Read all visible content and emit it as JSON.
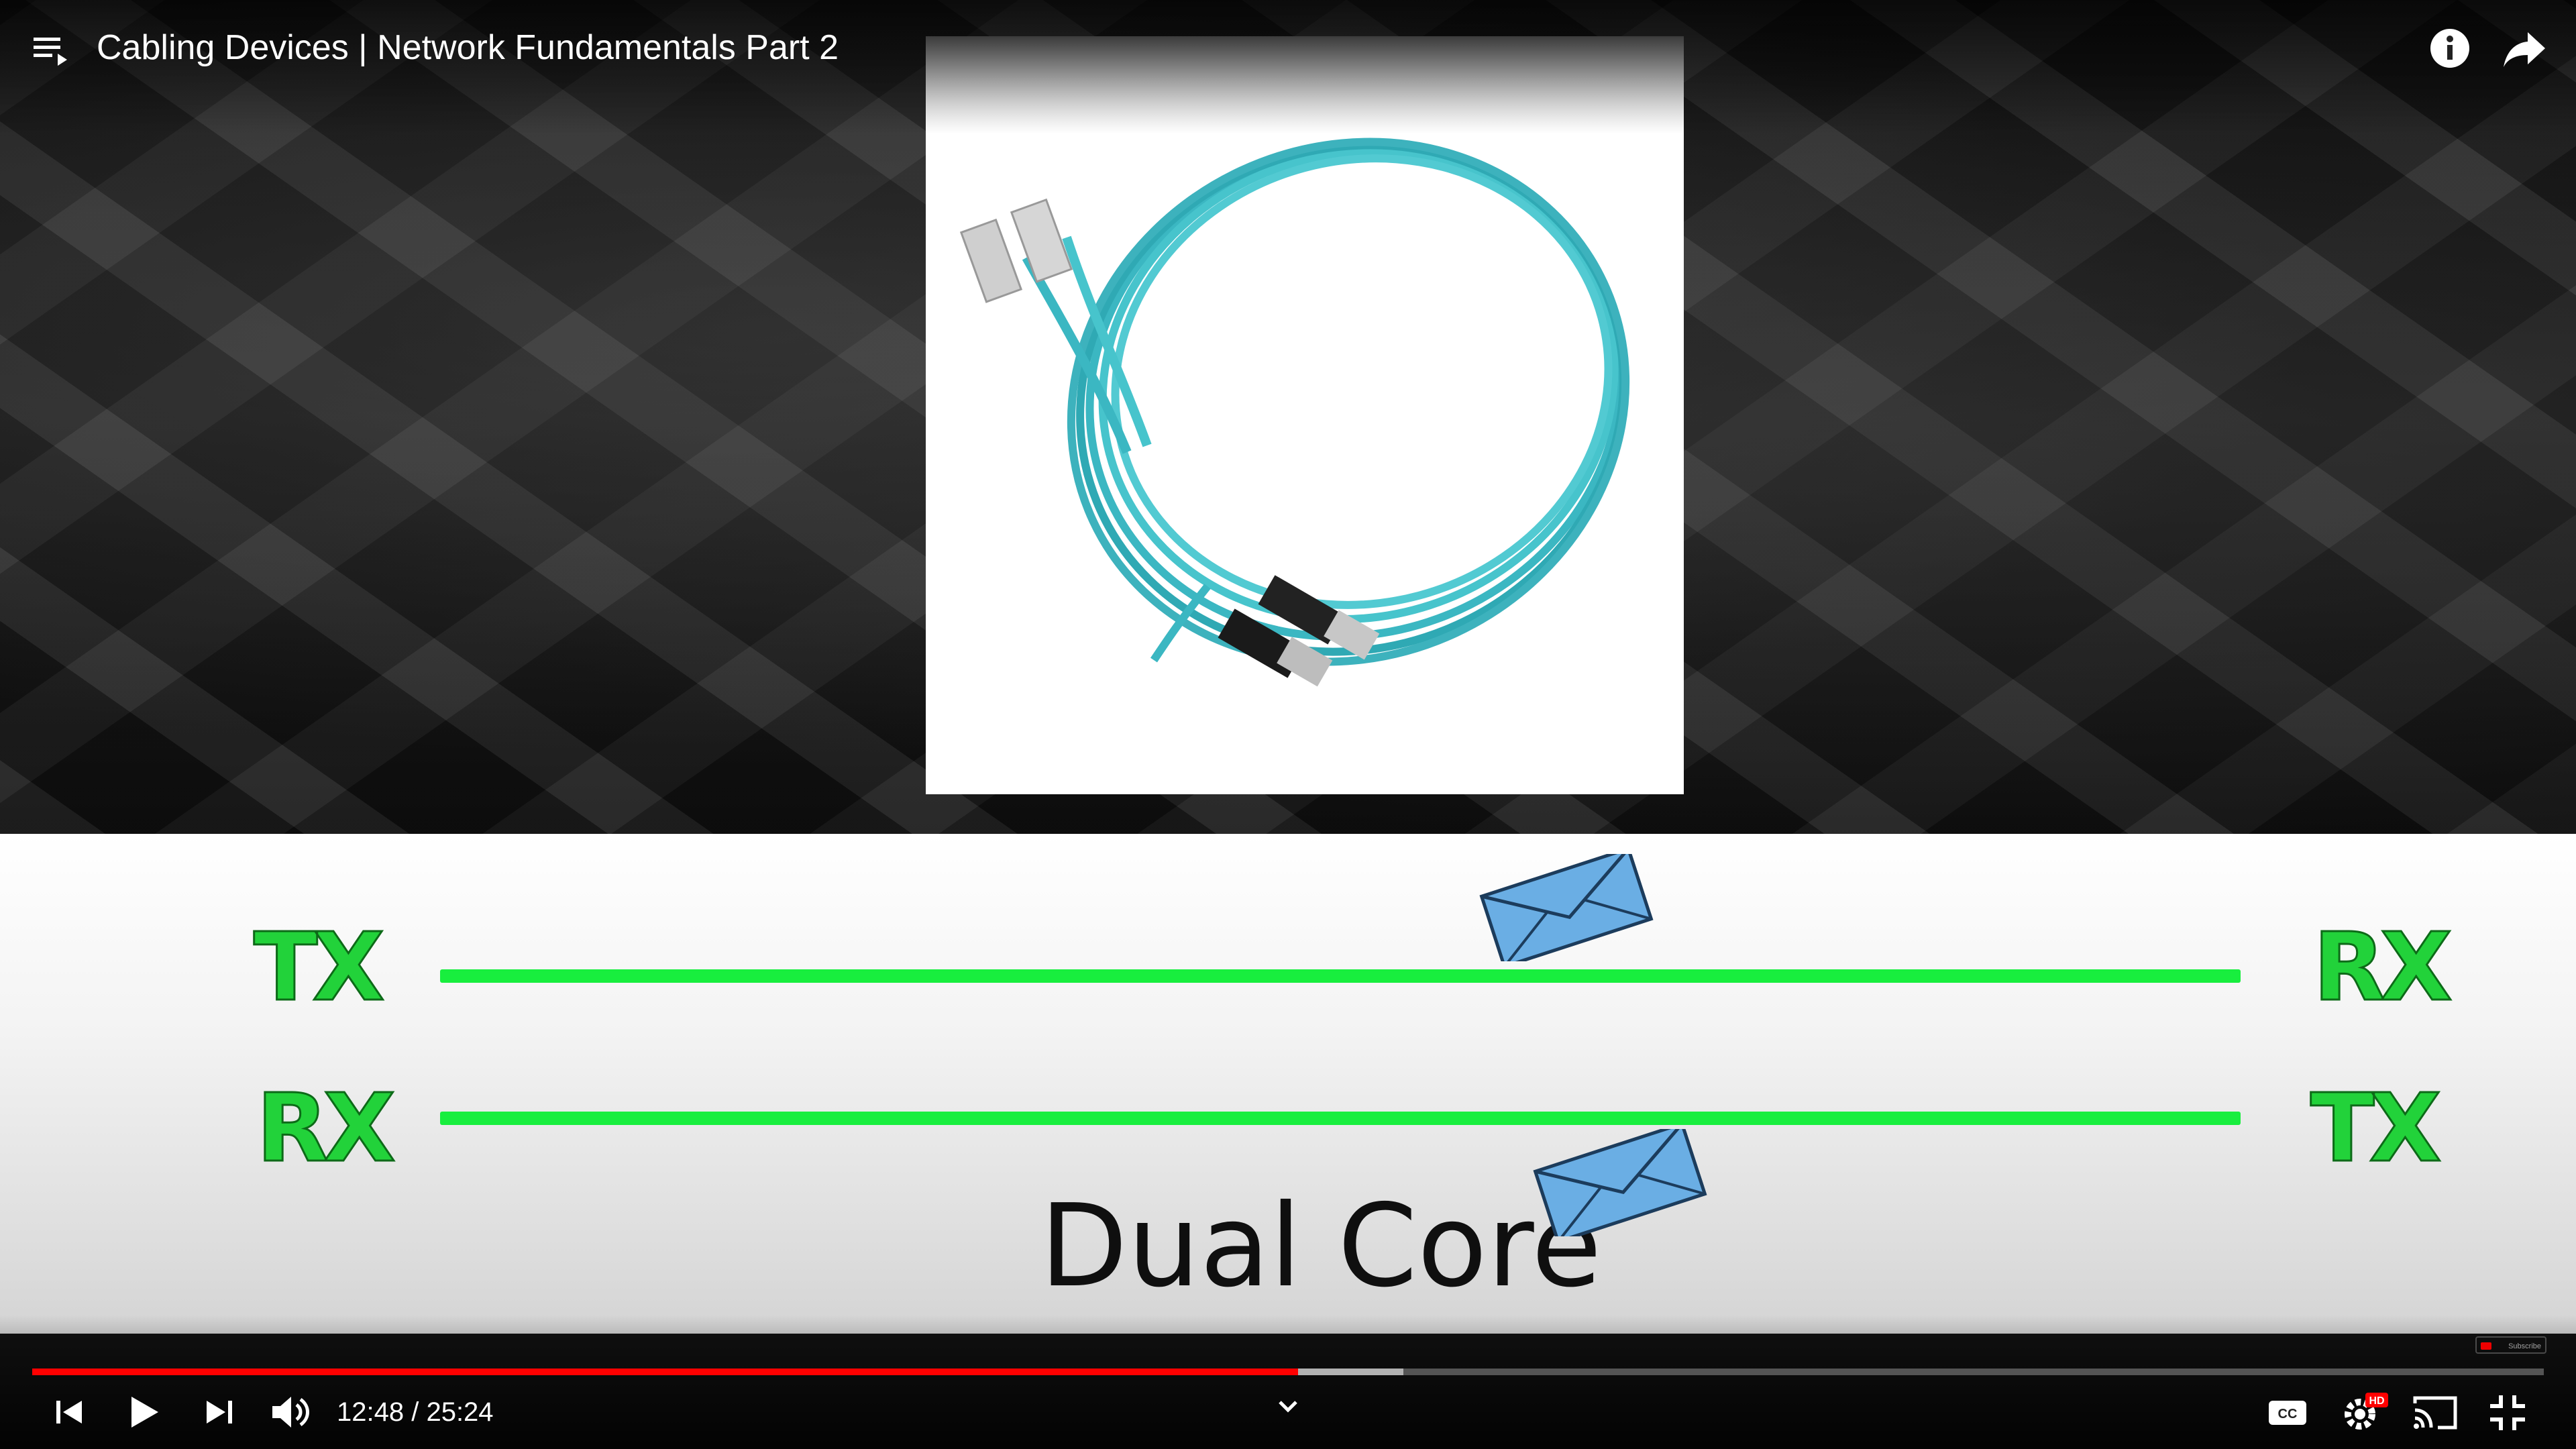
{
  "header": {
    "title": "Cabling Devices | Network Fundamentals Part 2"
  },
  "slide": {
    "top_left_label": "TX",
    "top_right_label": "RX",
    "bottom_left_label": "RX",
    "bottom_right_label": "TX",
    "caption": "Dual Core",
    "line_color": "#18ee3e",
    "label_color": "#22d23a",
    "envelope_color": "#6aaee4"
  },
  "player": {
    "current_time": "12:48",
    "separator": " / ",
    "duration": "25:24",
    "played_fraction": 0.504,
    "buffered_fraction": 0.546,
    "accent_color": "#ff0000",
    "hd_badge": "HD",
    "subscribe_watermark": "Subscribe",
    "icons": {
      "playlist": "playlist-icon",
      "info": "info-icon",
      "share": "share-icon",
      "previous": "skip-previous-icon",
      "play": "play-icon",
      "next": "skip-next-icon",
      "volume": "volume-icon",
      "chevron": "chevron-down-icon",
      "captions": "closed-captions-icon",
      "settings": "settings-gear-icon",
      "cast": "cast-icon",
      "exit_fullscreen": "exit-fullscreen-icon"
    }
  }
}
